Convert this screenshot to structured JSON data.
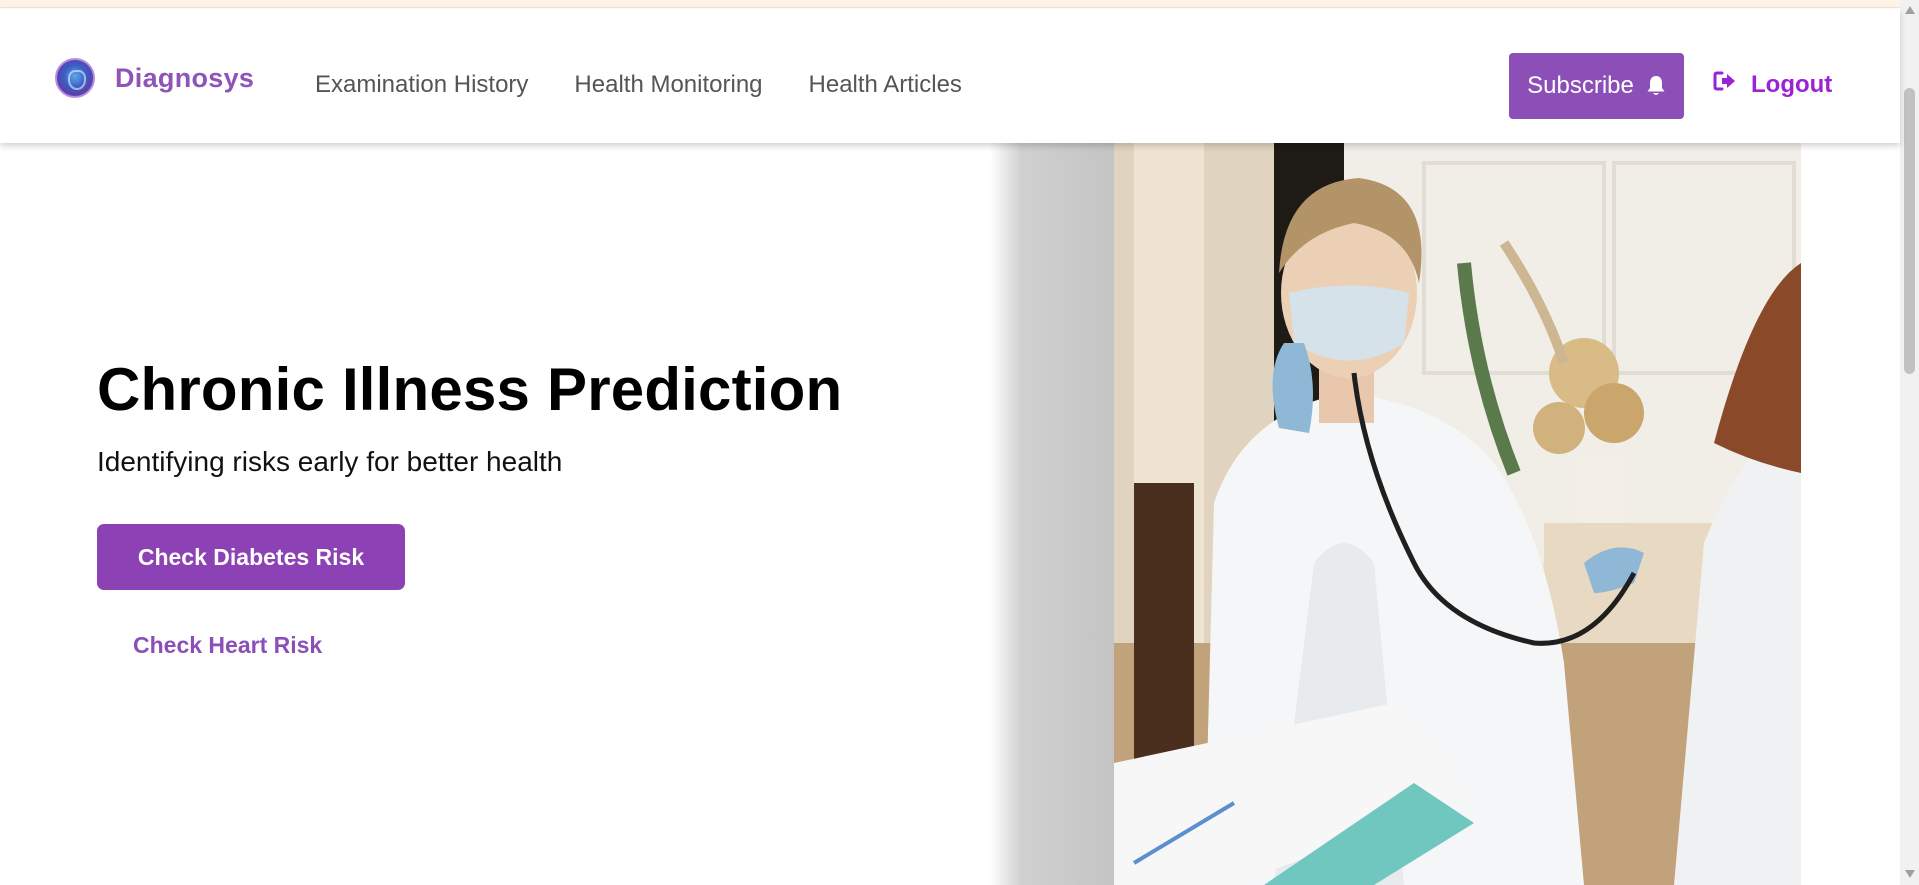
{
  "navbar": {
    "brand": "Diagnosys",
    "links": [
      {
        "label": "Examination History"
      },
      {
        "label": "Health Monitoring"
      },
      {
        "label": "Health Articles"
      }
    ],
    "subscribe_label": "Subscribe",
    "logout_label": "Logout"
  },
  "hero": {
    "title": "Chronic Illness Prediction",
    "subtitle": "Identifying risks early for better health",
    "primary_button": "Check Diabetes Risk",
    "secondary_link": "Check Heart Risk"
  },
  "icons": {
    "logo": "logo-icon",
    "subscribe": "bell-icon",
    "logout": "sign-out-icon"
  },
  "colors": {
    "brand_purple": "#8e54b8",
    "button_purple": "#8c42b4",
    "logout_magenta": "#9b23d6"
  }
}
